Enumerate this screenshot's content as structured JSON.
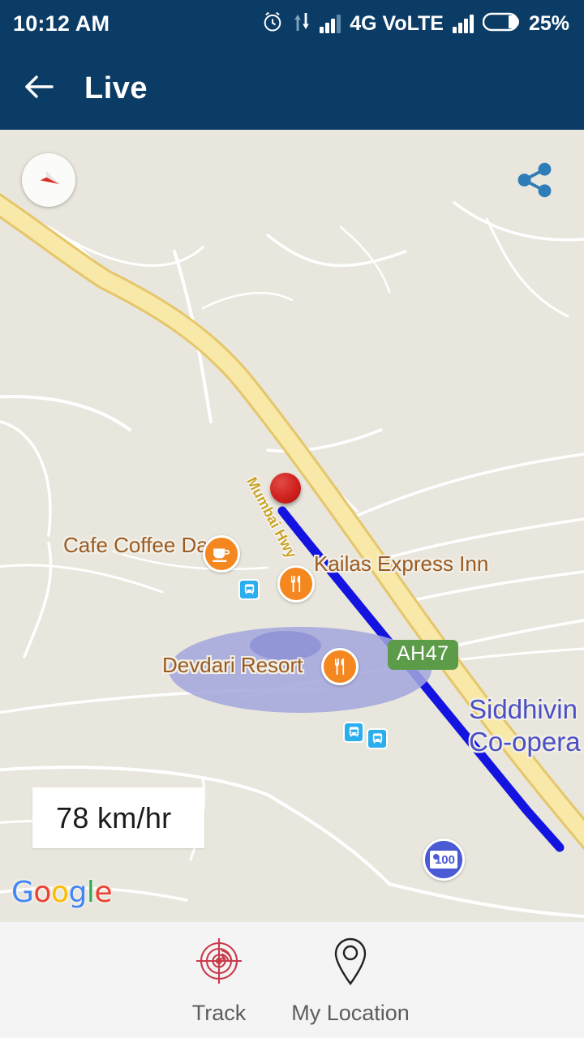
{
  "status_bar": {
    "clock": "10:12 AM",
    "network_type": "4G VoLTE",
    "battery_percent": "25%",
    "icons": [
      "alarm-icon",
      "data-transfer-icon",
      "signal-bars-1",
      "signal-bars-2",
      "battery-icon"
    ]
  },
  "app_bar": {
    "back_icon": "back-arrow-icon",
    "title": "Live"
  },
  "map": {
    "compass_icon": "compass-needle-icon",
    "share_icon": "share-icon",
    "attribution": {
      "g1": "G",
      "o1": "o",
      "o2": "o",
      "g2": "g",
      "l": "l",
      "e": "e"
    },
    "speed": "78 km/hr",
    "road_name": "Mumbai Hwy",
    "highway_shield": "AH47",
    "labels": [
      {
        "name": "Cafe Coffee Day",
        "icon": "coffee-cup-icon"
      },
      {
        "name": "Kailas Express Inn",
        "icon": "restaurant-icon"
      },
      {
        "name": "Devdari Resort",
        "icon": "restaurant-icon"
      }
    ],
    "bank_label_line1": "Siddhivin",
    "bank_label_line2": "Co-opera",
    "bank_icon_value": "100",
    "marker": "current-location-marker",
    "colors": {
      "route_line": "#1414e0",
      "highway_fill": "#f7e08a",
      "map_background": "#e9e6dd",
      "accuracy_circle": "#a3a6dd",
      "poi_orange": "#f4871f",
      "bus_stop": "#2aaeee",
      "shield_green": "#5c9c49",
      "marker_red": "#d1201d",
      "app_bar": "#0b3c66"
    }
  },
  "bottom_bar": {
    "actions": [
      {
        "label": "Track",
        "icon": "radar-target-icon"
      },
      {
        "label": "My Location",
        "icon": "map-pin-icon"
      }
    ]
  }
}
